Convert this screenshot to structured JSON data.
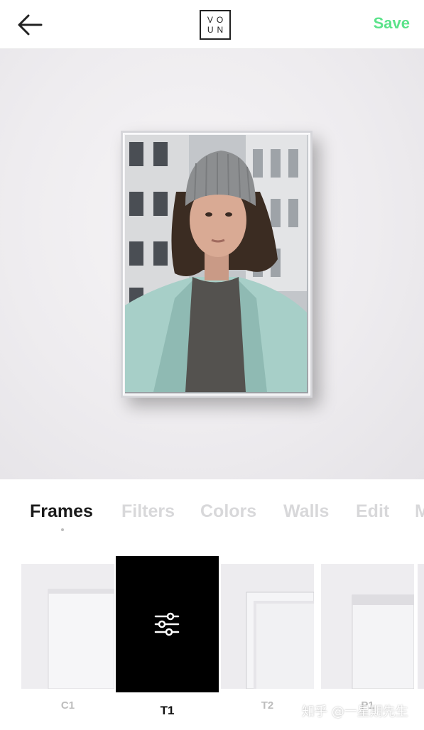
{
  "header": {
    "back_icon": "arrow-left-icon",
    "logo": {
      "row1": "VO",
      "row2": "UN"
    },
    "save_label": "Save",
    "accent_color": "#5be38a"
  },
  "preview": {
    "photo": "young woman in grey knit beanie and mint coat"
  },
  "tabs": [
    {
      "label": "Frames",
      "active": true
    },
    {
      "label": "Filters",
      "active": false
    },
    {
      "label": "Colors",
      "active": false
    },
    {
      "label": "Walls",
      "active": false
    },
    {
      "label": "Edit",
      "active": false
    },
    {
      "label": "M",
      "active": false
    }
  ],
  "frames": [
    {
      "label": "C1",
      "selected": false
    },
    {
      "label": "T1",
      "selected": true,
      "icon": "sliders-icon"
    },
    {
      "label": "T2",
      "selected": false
    },
    {
      "label": "P1",
      "selected": false
    }
  ],
  "watermark": "知乎 @一星期先生"
}
